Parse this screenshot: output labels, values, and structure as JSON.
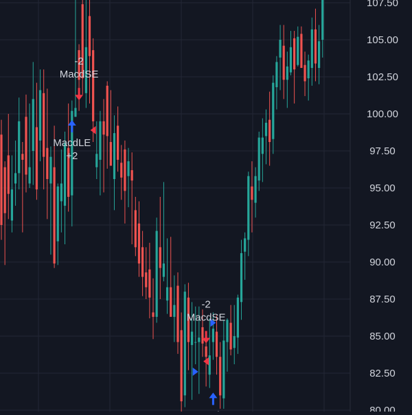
{
  "colors": {
    "background": "#131722",
    "grid": "#232735",
    "axis_divider": "#2a2e39",
    "axis_text": "#d1d4dc",
    "up": "#26a69a",
    "down": "#ef5350",
    "long_marker": "#2962ff",
    "short_marker": "#f23645",
    "signal_text": "#d1d4dc"
  },
  "chart_data": {
    "type": "candlestick",
    "y_axis": {
      "ticks": [
        "107.50",
        "105.00",
        "102.50",
        "100.00",
        "97.50",
        "95.00",
        "92.50",
        "90.00",
        "87.50",
        "85.00",
        "82.50",
        "80.00"
      ],
      "range": [
        79.9,
        107.8
      ],
      "position": "right",
      "grid": true
    },
    "candles": [
      {
        "o": 98.6,
        "h": 99.6,
        "l": 91.5,
        "c": 92.5
      },
      {
        "o": 96.4,
        "h": 96.8,
        "l": 89.8,
        "c": 93.3
      },
      {
        "o": 97.2,
        "h": 100.0,
        "l": 92.9,
        "c": 94.6
      },
      {
        "o": 92.8,
        "h": 97.2,
        "l": 92.0,
        "c": 94.9
      },
      {
        "o": 95.3,
        "h": 98.2,
        "l": 93.8,
        "c": 96.0
      },
      {
        "o": 96.0,
        "h": 101.1,
        "l": 94.9,
        "c": 99.5
      },
      {
        "o": 97.3,
        "h": 98.1,
        "l": 92.0,
        "c": 96.9
      },
      {
        "o": 99.8,
        "h": 101.3,
        "l": 94.7,
        "c": 95.9
      },
      {
        "o": 95.3,
        "h": 100.7,
        "l": 95.0,
        "c": 96.4
      },
      {
        "o": 97.5,
        "h": 103.5,
        "l": 95.2,
        "c": 101.0
      },
      {
        "o": 99.1,
        "h": 102.1,
        "l": 94.2,
        "c": 94.9
      },
      {
        "o": 98.2,
        "h": 103.0,
        "l": 96.8,
        "c": 101.6
      },
      {
        "o": 101.4,
        "h": 103.0,
        "l": 94.9,
        "c": 97.1
      },
      {
        "o": 97.7,
        "h": 101.7,
        "l": 92.9,
        "c": 95.6
      },
      {
        "o": 95.3,
        "h": 97.8,
        "l": 90.5,
        "c": 97.1
      },
      {
        "o": 96.4,
        "h": 99.2,
        "l": 89.6,
        "c": 89.9
      },
      {
        "o": 91.4,
        "h": 95.3,
        "l": 89.8,
        "c": 95.1
      },
      {
        "o": 94.1,
        "h": 97.6,
        "l": 92.0,
        "c": 95.3
      },
      {
        "o": 93.8,
        "h": 98.8,
        "l": 91.2,
        "c": 98.0
      },
      {
        "o": 97.7,
        "h": 100.7,
        "l": 93.4,
        "c": 94.4
      },
      {
        "o": 94.5,
        "h": 100.9,
        "l": 92.4,
        "c": 100.2
      },
      {
        "o": 99.8,
        "h": 107.8,
        "l": 99.8,
        "c": 100.4
      },
      {
        "o": 104.3,
        "h": 104.7,
        "l": 100.2,
        "c": 102.3
      },
      {
        "o": 107.4,
        "h": 107.8,
        "l": 101.3,
        "c": 102.4
      },
      {
        "o": 101.4,
        "h": 107.8,
        "l": 100.4,
        "c": 104.5
      },
      {
        "o": 106.6,
        "h": 107.8,
        "l": 100.7,
        "c": 103.9
      },
      {
        "o": 104.3,
        "h": 105.1,
        "l": 98.1,
        "c": 99.5
      },
      {
        "o": 96.4,
        "h": 99.5,
        "l": 95.6,
        "c": 97.3
      },
      {
        "o": 96.9,
        "h": 100.2,
        "l": 94.5,
        "c": 99.5
      },
      {
        "o": 99.5,
        "h": 101.0,
        "l": 94.7,
        "c": 98.6
      },
      {
        "o": 101.9,
        "h": 102.2,
        "l": 96.3,
        "c": 98.5
      },
      {
        "o": 98.1,
        "h": 101.6,
        "l": 97.5,
        "c": 96.5
      },
      {
        "o": 95.6,
        "h": 99.9,
        "l": 93.5,
        "c": 98.7
      },
      {
        "o": 99.2,
        "h": 100.5,
        "l": 96.1,
        "c": 96.9
      },
      {
        "o": 96.7,
        "h": 97.9,
        "l": 94.2,
        "c": 95.7
      },
      {
        "o": 97.6,
        "h": 98.2,
        "l": 92.6,
        "c": 94.8
      },
      {
        "o": 95.8,
        "h": 97.7,
        "l": 93.7,
        "c": 96.8
      },
      {
        "o": 96.2,
        "h": 97.4,
        "l": 91.2,
        "c": 95.5
      },
      {
        "o": 93.5,
        "h": 94.4,
        "l": 90.4,
        "c": 91.0
      },
      {
        "o": 92.6,
        "h": 94.1,
        "l": 89.0,
        "c": 89.9
      },
      {
        "o": 91.0,
        "h": 92.1,
        "l": 87.7,
        "c": 89.0
      },
      {
        "o": 89.3,
        "h": 91.0,
        "l": 87.5,
        "c": 88.3
      },
      {
        "o": 89.5,
        "h": 91.3,
        "l": 86.2,
        "c": 87.6
      },
      {
        "o": 86.6,
        "h": 88.9,
        "l": 84.8,
        "c": 86.3
      },
      {
        "o": 86.3,
        "h": 93.0,
        "l": 85.9,
        "c": 92.1
      },
      {
        "o": 91.0,
        "h": 94.4,
        "l": 87.5,
        "c": 89.6
      },
      {
        "o": 89.0,
        "h": 95.4,
        "l": 88.7,
        "c": 89.9
      },
      {
        "o": 87.4,
        "h": 91.6,
        "l": 86.5,
        "c": 88.3
      },
      {
        "o": 88.3,
        "h": 91.7,
        "l": 86.5,
        "c": 86.3
      },
      {
        "o": 86.3,
        "h": 89.1,
        "l": 84.6,
        "c": 87.1
      },
      {
        "o": 88.4,
        "h": 89.3,
        "l": 83.8,
        "c": 84.6
      },
      {
        "o": 85.4,
        "h": 86.6,
        "l": 79.9,
        "c": 80.6
      },
      {
        "o": 81.0,
        "h": 88.5,
        "l": 80.2,
        "c": 88.0
      },
      {
        "o": 87.6,
        "h": 88.6,
        "l": 82.7,
        "c": 84.6
      },
      {
        "o": 84.4,
        "h": 87.3,
        "l": 80.7,
        "c": 85.3
      },
      {
        "o": 84.6,
        "h": 87.0,
        "l": 83.1,
        "c": 84.6
      },
      {
        "o": 84.6,
        "h": 87.0,
        "l": 81.1,
        "c": 84.9
      },
      {
        "o": 85.6,
        "h": 86.8,
        "l": 83.6,
        "c": 84.5
      },
      {
        "o": 84.3,
        "h": 85.1,
        "l": 81.6,
        "c": 83.6
      },
      {
        "o": 82.4,
        "h": 86.2,
        "l": 81.5,
        "c": 83.7
      },
      {
        "o": 84.6,
        "h": 86.6,
        "l": 83.4,
        "c": 85.5
      },
      {
        "o": 85.3,
        "h": 86.4,
        "l": 82.4,
        "c": 83.6
      },
      {
        "o": 83.6,
        "h": 84.6,
        "l": 80.1,
        "c": 81.0
      },
      {
        "o": 80.8,
        "h": 86.1,
        "l": 80.1,
        "c": 84.7
      },
      {
        "o": 84.6,
        "h": 86.2,
        "l": 82.6,
        "c": 86.1
      },
      {
        "o": 85.9,
        "h": 87.1,
        "l": 83.7,
        "c": 84.1
      },
      {
        "o": 84.2,
        "h": 87.1,
        "l": 83.1,
        "c": 85.0
      },
      {
        "o": 84.9,
        "h": 87.8,
        "l": 83.8,
        "c": 87.6
      },
      {
        "o": 87.3,
        "h": 91.5,
        "l": 86.1,
        "c": 90.6
      },
      {
        "o": 90.7,
        "h": 92.0,
        "l": 88.8,
        "c": 91.6
      },
      {
        "o": 91.5,
        "h": 96.1,
        "l": 90.4,
        "c": 95.8
      },
      {
        "o": 95.1,
        "h": 96.8,
        "l": 92.0,
        "c": 94.2
      },
      {
        "o": 94.0,
        "h": 96.4,
        "l": 93.0,
        "c": 95.8
      },
      {
        "o": 95.5,
        "h": 98.8,
        "l": 94.8,
        "c": 98.4
      },
      {
        "o": 97.3,
        "h": 99.7,
        "l": 95.4,
        "c": 98.4
      },
      {
        "o": 98.5,
        "h": 100.3,
        "l": 96.6,
        "c": 99.4
      },
      {
        "o": 99.6,
        "h": 101.5,
        "l": 96.5,
        "c": 98.1
      },
      {
        "o": 98.3,
        "h": 102.6,
        "l": 97.3,
        "c": 102.1
      },
      {
        "o": 101.8,
        "h": 103.9,
        "l": 100.3,
        "c": 103.5
      },
      {
        "o": 103.8,
        "h": 106.0,
        "l": 101.6,
        "c": 105.0
      },
      {
        "o": 104.6,
        "h": 106.0,
        "l": 101.0,
        "c": 102.3
      },
      {
        "o": 102.3,
        "h": 104.2,
        "l": 100.4,
        "c": 103.2
      },
      {
        "o": 102.8,
        "h": 105.6,
        "l": 102.6,
        "c": 104.5
      },
      {
        "o": 105.1,
        "h": 105.6,
        "l": 100.7,
        "c": 103.0
      },
      {
        "o": 103.3,
        "h": 105.9,
        "l": 103.2,
        "c": 105.2
      },
      {
        "o": 105.4,
        "h": 105.9,
        "l": 103.7,
        "c": 103.1
      },
      {
        "o": 103.3,
        "h": 104.2,
        "l": 101.2,
        "c": 102.2
      },
      {
        "o": 102.4,
        "h": 104.0,
        "l": 100.9,
        "c": 103.6
      },
      {
        "o": 103.1,
        "h": 106.5,
        "l": 101.9,
        "c": 105.7
      },
      {
        "o": 105.7,
        "h": 107.1,
        "l": 102.2,
        "c": 103.4
      },
      {
        "o": 103.1,
        "h": 106.0,
        "l": 102.0,
        "c": 104.9
      },
      {
        "o": 105.0,
        "h": 107.9,
        "l": 103.8,
        "c": 107.8
      }
    ],
    "signals": [
      {
        "kind": "short",
        "label": "MacdSE",
        "qty": "-2",
        "index": 22,
        "price": 101.1
      },
      {
        "kind": "long",
        "label": "MacdLE",
        "qty": "+2",
        "index": 20,
        "price": 99.4
      },
      {
        "kind": "short",
        "label": "MacdSE",
        "qty": "-2",
        "index": 58,
        "price": 84.7
      },
      {
        "kind": "long",
        "label": "MacdLE",
        "qty": "",
        "index": 60,
        "price": 81.0
      }
    ],
    "tri_markers": [
      {
        "dir": "left",
        "index": 26,
        "price": 98.9
      },
      {
        "dir": "right",
        "index": 60,
        "price": 85.9
      },
      {
        "dir": "left",
        "index": 58,
        "price": 83.3
      },
      {
        "dir": "right",
        "index": 55,
        "price": 82.6
      }
    ]
  }
}
